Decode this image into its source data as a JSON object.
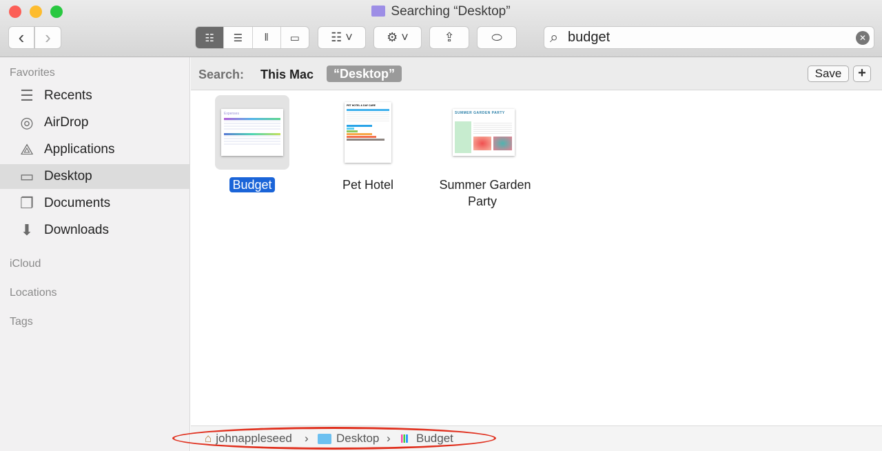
{
  "window": {
    "title": "Searching “Desktop”"
  },
  "toolbar": {
    "back": "‹",
    "forward": "›",
    "views": [
      {
        "name": "icon-view",
        "glyph": "☷",
        "active": true
      },
      {
        "name": "list-view",
        "glyph": "☰",
        "active": false
      },
      {
        "name": "column-view",
        "glyph": "‖",
        "active": false
      },
      {
        "name": "gallery-view",
        "glyph": "▭",
        "active": false
      }
    ],
    "group_glyph": "☷ ˅",
    "action_glyph": "⚙ ˅",
    "share_glyph": "⇪",
    "tag_glyph": "⬭",
    "search_value": "budget",
    "search_icon": "⌕",
    "clear_icon": "✕"
  },
  "sidebar": {
    "sections": [
      "Favorites",
      "iCloud",
      "Locations",
      "Tags"
    ],
    "items": [
      {
        "label": "Recents",
        "icon": "☰",
        "selected": false
      },
      {
        "label": "AirDrop",
        "icon": "◎",
        "selected": false
      },
      {
        "label": "Applications",
        "icon": "⟁",
        "selected": false
      },
      {
        "label": "Desktop",
        "icon": "▭",
        "selected": true
      },
      {
        "label": "Documents",
        "icon": "❐",
        "selected": false
      },
      {
        "label": "Downloads",
        "icon": "⬇",
        "selected": false
      }
    ]
  },
  "scope": {
    "label": "Search:",
    "this_mac": "This Mac",
    "desktop": "“Desktop”",
    "save": "Save",
    "add": "+"
  },
  "files": [
    {
      "name": "Budget",
      "selected": true,
      "thumb_title": "Expenses"
    },
    {
      "name": "Pet Hotel",
      "selected": false,
      "thumb_title": "PET HOTEL & DAY CARE"
    },
    {
      "name": "Summer Garden Party",
      "selected": false,
      "thumb_title": "SUMMER GARDEN PARTY"
    }
  ],
  "path": [
    {
      "label": "johnappleseed",
      "icon": "home-icon"
    },
    {
      "label": "Desktop",
      "icon": "folder-icon"
    },
    {
      "label": "Budget",
      "icon": "numbers-file-icon"
    }
  ],
  "path_separator": "›",
  "colors": {
    "selection": "#1a64d8",
    "annotation": "#e0301e",
    "close": "#fc5f57",
    "minimize": "#fdbc2e",
    "zoom": "#28c840"
  }
}
